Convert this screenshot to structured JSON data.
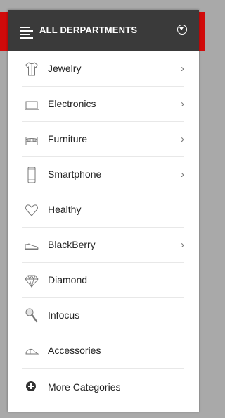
{
  "menu": {
    "title": "ALL DERPARTMENTS",
    "items": [
      {
        "label": "Jewelry",
        "icon": "shirt-icon",
        "submenu": true
      },
      {
        "label": "Electronics",
        "icon": "laptop-icon",
        "submenu": true
      },
      {
        "label": "Furniture",
        "icon": "bed-icon",
        "submenu": true
      },
      {
        "label": "Smartphone",
        "icon": "smartphone-icon",
        "submenu": true
      },
      {
        "label": "Healthy",
        "icon": "heart-icon",
        "submenu": false
      },
      {
        "label": "BlackBerry",
        "icon": "shoe-icon",
        "submenu": true
      },
      {
        "label": "Diamond",
        "icon": "diamond-icon",
        "submenu": false
      },
      {
        "label": "Infocus",
        "icon": "magnifier-icon",
        "submenu": false
      },
      {
        "label": "Accessories",
        "icon": "cap-icon",
        "submenu": false
      }
    ],
    "more_label": "More Categories"
  },
  "colors": {
    "header_bg": "#3a3a3a",
    "accent_red": "#d10a0a",
    "page_bg": "#a9a9a9"
  }
}
